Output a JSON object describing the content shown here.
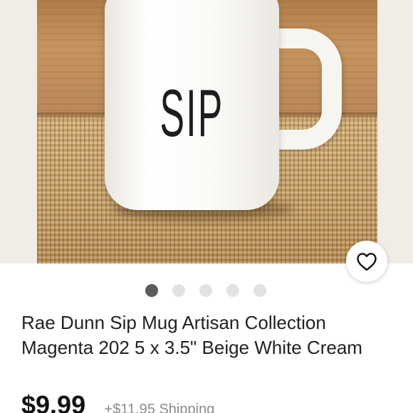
{
  "product": {
    "image_text": "SIP",
    "title": "Rae Dunn Sip Mug Artisan Collection Magenta 202 5 x 3.5\" Beige White Cream",
    "price": "$9.99",
    "shipping": "+$11.95 Shipping"
  },
  "carousel": {
    "total": 5,
    "active_index": 0
  },
  "icons": {
    "favorite": "heart-outline-icon"
  },
  "colors": {
    "dot_active": "#5b5b5b",
    "dot_inactive": "#e2e2e2",
    "text": "#222222"
  }
}
